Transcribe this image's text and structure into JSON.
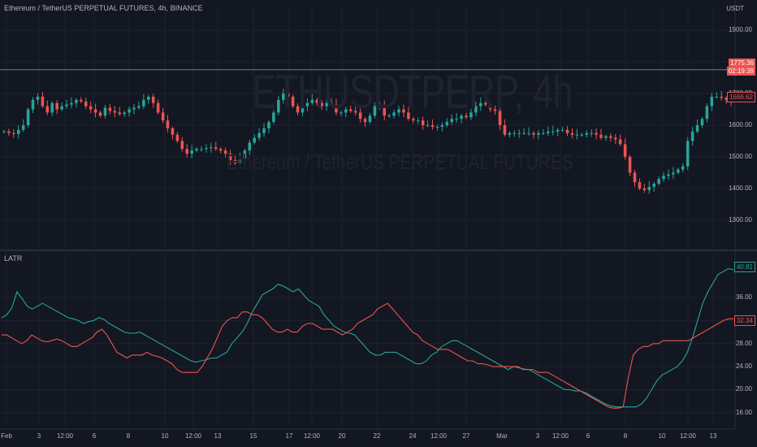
{
  "header": {
    "title": "Ethereum / TetherUS PERPETUAL FUTURES, 4h, BINANCE",
    "currency": "USDT"
  },
  "watermark": {
    "symbol": "ETHUSDTPERP, 4h",
    "description": "Ethereum / TetherUS PERPETUAL FUTURES"
  },
  "colors": {
    "bg": "#131722",
    "up": "#26a69a",
    "down": "#ef5350",
    "grid": "#1e222d",
    "text": "#b2b5be"
  },
  "price_tags": {
    "last_price": "1775.36",
    "countdown": "02:19:39",
    "current": "1666.62"
  },
  "indicator": {
    "name": "LATR",
    "tag_green": "40.81",
    "tag_red": "32.34"
  },
  "chart_data": [
    {
      "type": "candlestick",
      "title": "Ethereum / TetherUS PERPETUAL FUTURES, 4h, BINANCE",
      "ylabel": "USDT",
      "ylim": [
        1220,
        1975
      ],
      "yticks": [
        "1900.00",
        "1800.00",
        "1700.00",
        "1600.00",
        "1500.00",
        "1400.00",
        "1300.00"
      ],
      "ytick_values": [
        1900,
        1800,
        1700,
        1600,
        1500,
        1400,
        1300
      ],
      "horizontal_line": 1775.36,
      "series": [
        {
          "name": "close",
          "values": [
            1580,
            1575,
            1572,
            1585,
            1600,
            1650,
            1680,
            1690,
            1660,
            1640,
            1670,
            1650,
            1660,
            1665,
            1670,
            1680,
            1675,
            1660,
            1650,
            1640,
            1630,
            1655,
            1645,
            1640,
            1635,
            1640,
            1650,
            1655,
            1660,
            1680,
            1690,
            1670,
            1640,
            1615,
            1590,
            1570,
            1550,
            1525,
            1510,
            1520,
            1525,
            1525,
            1528,
            1530,
            1525,
            1520,
            1510,
            1490,
            1480,
            1495,
            1520,
            1545,
            1560,
            1575,
            1590,
            1610,
            1640,
            1680,
            1700,
            1690,
            1660,
            1640,
            1660,
            1670,
            1680,
            1670,
            1660,
            1670,
            1665,
            1640,
            1640,
            1650,
            1645,
            1640,
            1620,
            1610,
            1630,
            1660,
            1660,
            1630,
            1630,
            1640,
            1650,
            1640,
            1620,
            1615,
            1615,
            1600,
            1600,
            1595,
            1595,
            1600,
            1610,
            1620,
            1620,
            1630,
            1625,
            1640,
            1660,
            1670,
            1665,
            1650,
            1645,
            1600,
            1570,
            1575,
            1575,
            1575,
            1575,
            1575,
            1570,
            1575,
            1575,
            1580,
            1580,
            1585,
            1585,
            1575,
            1570,
            1570,
            1570,
            1575,
            1575,
            1570,
            1560,
            1565,
            1560,
            1555,
            1540,
            1500,
            1450,
            1420,
            1400,
            1395,
            1405,
            1415,
            1430,
            1440,
            1445,
            1450,
            1460,
            1470,
            1550,
            1580,
            1600,
            1620,
            1660,
            1690,
            1690,
            1686,
            1680,
            1675
          ]
        }
      ],
      "x_labels": [
        "Feb",
        "3",
        "12:00",
        "6",
        "8",
        "10",
        "12:00",
        "13",
        "15",
        "17",
        "12:00",
        "20",
        "22",
        "24",
        "12:00",
        "27",
        "Mar",
        "3",
        "12:00",
        "6",
        "8",
        "10",
        "12:00",
        "13"
      ]
    },
    {
      "type": "line",
      "title": "LATR",
      "ylim": [
        14,
        42.5
      ],
      "yticks": [
        "16.00",
        "20.00",
        "24.00",
        "28.00",
        "32.00",
        "36.00"
      ],
      "ytick_values": [
        16,
        20,
        24,
        28,
        32,
        36
      ],
      "x_labels": [
        "Feb",
        "3",
        "12:00",
        "6",
        "8",
        "10",
        "12:00",
        "13",
        "15",
        "17",
        "12:00",
        "20",
        "22",
        "24",
        "12:00",
        "27",
        "Mar",
        "3",
        "12:00",
        "6",
        "8",
        "10",
        "12:00",
        "13"
      ],
      "series": [
        {
          "name": "green",
          "color": "#26a69a",
          "values": [
            32.5,
            33.0,
            34.2,
            37.0,
            35.8,
            34.5,
            34.0,
            34.5,
            35.0,
            34.5,
            34.0,
            33.5,
            33.0,
            32.5,
            32.3,
            32.0,
            31.5,
            31.8,
            32.0,
            32.5,
            32.2,
            31.5,
            31.0,
            30.5,
            30.0,
            29.8,
            29.8,
            30.0,
            29.5,
            29.0,
            28.5,
            28.0,
            27.5,
            27.0,
            26.5,
            26.0,
            25.5,
            25.0,
            24.8,
            25.0,
            25.2,
            25.5,
            25.5,
            26.0,
            26.5,
            28.0,
            29.0,
            30.0,
            31.5,
            33.5,
            35.0,
            36.5,
            37.0,
            37.5,
            38.3,
            38.0,
            37.5,
            37.0,
            37.5,
            36.5,
            35.5,
            35.0,
            34.5,
            33.0,
            32.0,
            31.0,
            30.5,
            30.0,
            29.8,
            29.5,
            28.5,
            27.5,
            26.5,
            26.0,
            26.0,
            26.5,
            26.5,
            26.5,
            26.0,
            25.5,
            25.0,
            24.5,
            24.5,
            25.0,
            26.0,
            26.5,
            27.5,
            28.0,
            28.5,
            28.5,
            28.0,
            27.5,
            27.0,
            26.5,
            26.0,
            25.5,
            25.0,
            24.5,
            24.0,
            23.5,
            24.0,
            23.8,
            23.6,
            23.5,
            23.0,
            22.5,
            22.0,
            21.5,
            21.0,
            20.5,
            20.0,
            20.0,
            19.8,
            19.8,
            19.5,
            19.0,
            18.5,
            18.0,
            17.5,
            17.2,
            17.0,
            17.0,
            17.0,
            17.0,
            17.0,
            17.5,
            18.5,
            20.0,
            21.5,
            22.5,
            23.0,
            23.5,
            24.0,
            25.0,
            26.5,
            29.0,
            32.0,
            35.0,
            37.0,
            38.5,
            40.0,
            40.5,
            41.0,
            40.8
          ]
        },
        {
          "name": "red",
          "color": "#ef5350",
          "values": [
            29.5,
            29.5,
            29.0,
            28.5,
            28.0,
            28.5,
            29.5,
            29.0,
            28.5,
            28.3,
            28.5,
            28.8,
            28.5,
            28.0,
            27.5,
            27.5,
            28.0,
            28.5,
            29.0,
            30.0,
            30.5,
            29.5,
            28.0,
            26.5,
            26.0,
            25.5,
            26.0,
            26.0,
            26.0,
            26.5,
            26.0,
            25.8,
            25.5,
            25.0,
            24.5,
            23.5,
            23.0,
            23.0,
            23.0,
            23.0,
            24.0,
            25.5,
            27.0,
            29.0,
            31.0,
            32.0,
            32.5,
            32.5,
            33.5,
            33.5,
            33.0,
            33.0,
            32.5,
            31.5,
            30.5,
            30.0,
            30.0,
            30.5,
            30.0,
            30.0,
            31.0,
            31.5,
            31.5,
            31.0,
            30.5,
            30.5,
            30.5,
            30.0,
            29.5,
            30.0,
            30.5,
            31.5,
            32.0,
            32.5,
            33.0,
            34.0,
            34.5,
            35.0,
            34.0,
            33.0,
            32.0,
            31.0,
            30.0,
            29.5,
            28.5,
            28.0,
            27.5,
            27.0,
            27.0,
            27.0,
            26.5,
            26.0,
            25.5,
            25.0,
            25.0,
            24.5,
            24.5,
            24.3,
            24.0,
            24.0,
            24.0,
            24.0,
            24.0,
            24.0,
            23.5,
            23.5,
            23.5,
            23.0,
            23.0,
            23.0,
            22.5,
            22.0,
            21.5,
            21.0,
            20.5,
            20.0,
            19.5,
            19.0,
            18.5,
            18.0,
            17.5,
            17.0,
            16.8,
            16.8,
            17.0,
            22.0,
            26.0,
            27.0,
            27.5,
            27.5,
            28.0,
            28.0,
            28.5,
            28.5,
            28.5,
            28.5,
            28.5,
            28.5,
            29.0,
            29.5,
            30.0,
            30.5,
            31.0,
            31.5,
            32.0,
            32.3,
            32.3
          ]
        }
      ]
    }
  ]
}
